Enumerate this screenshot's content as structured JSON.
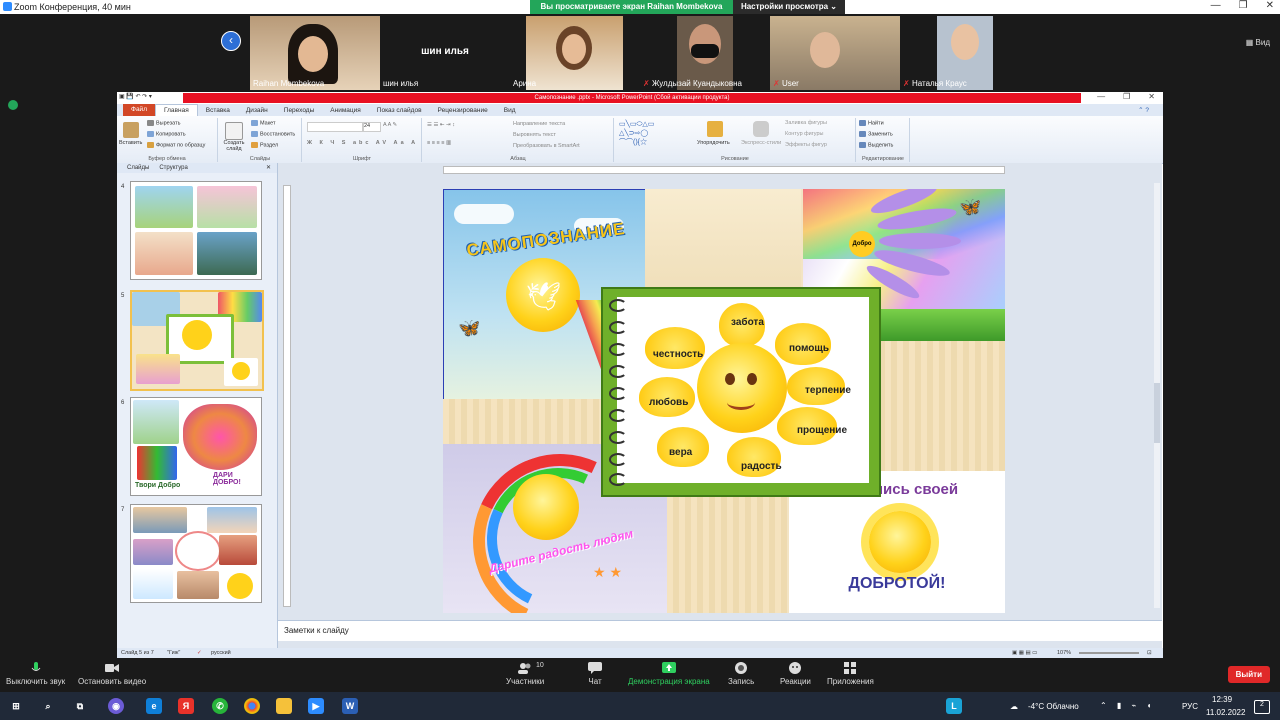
{
  "zoom": {
    "title": "Zoom Конференция, 40 мин",
    "share_banner": "Вы просматриваете экран Raihan Mombekova",
    "view_settings": "Настройки просмотра ⌄",
    "view_button": "Вид",
    "participants": [
      {
        "name": "Raihan Mombekova",
        "muted": false
      },
      {
        "name": "шин илья",
        "muted": false,
        "big_label": "шин илья"
      },
      {
        "name": "Арина",
        "muted": false
      },
      {
        "name": "Жулдызай Куандыковна",
        "muted": true
      },
      {
        "name": "User",
        "muted": true
      },
      {
        "name": "Наталья Краус",
        "muted": true
      }
    ],
    "toolbar": {
      "mute": "Выключить звук",
      "video": "Остановить видео",
      "participants": "Участники",
      "participants_count": "10",
      "chat": "Чат",
      "share": "Демонстрация экрана",
      "record": "Запись",
      "reactions": "Реакции",
      "apps": "Приложения",
      "exit": "Выйти"
    }
  },
  "ppt": {
    "window_title": "Самопознание .pptx - Microsoft PowerPoint (Сбой активации продукта)",
    "tabs": [
      "Файл",
      "Главная",
      "Вставка",
      "Дизайн",
      "Переходы",
      "Анимация",
      "Показ слайдов",
      "Рецензирование",
      "Вид"
    ],
    "ribbon": {
      "clipboard": {
        "label": "Буфер обмена",
        "paste": "Вставить",
        "cut": "Вырезать",
        "copy": "Копировать",
        "format": "Формат по образцу"
      },
      "slides": {
        "label": "Слайды",
        "create": "Создать слайд",
        "layout": "Макет",
        "reset": "Восстановить",
        "section": "Раздел"
      },
      "font": {
        "label": "Шрифт",
        "size": "24"
      },
      "paragraph": {
        "label": "Абзац",
        "direction": "Направление текста",
        "align": "Выровнять текст",
        "smartart": "Преобразовать в SmartArt"
      },
      "drawing": {
        "label": "Рисование",
        "arrange": "Упорядочить",
        "styles": "Экспресс-стили",
        "fill": "Заливка фигуры",
        "outline": "Контур фигуры",
        "effects": "Эффекты фигур"
      },
      "editing": {
        "label": "Редактирование",
        "find": "Найти",
        "replace": "Заменить",
        "select": "Выделить"
      }
    },
    "panel_tabs": [
      "Слайды",
      "Структура"
    ],
    "slide_numbers": [
      "4",
      "5",
      "6",
      "7"
    ],
    "thumb_texts": {
      "t6a": "Твори Добро",
      "t6b": "ДАРИ ДОБРО!"
    },
    "notes_placeholder": "Заметки к слайду",
    "status": {
      "slide": "Слайд 5 из 7",
      "theme": "\"Гиж\"",
      "lang": "русский",
      "zoom": "107%"
    },
    "slide": {
      "title_arc": "САМОПОЗНАНИЕ",
      "sun_words": [
        "забота",
        "помощь",
        "терпение",
        "прощение",
        "радость",
        "вера",
        "любовь",
        "честность"
      ],
      "rainbow_text": "Дарите радость людям",
      "share_kindness_1": "Поделись своей",
      "share_kindness_2": "ДОБРОТОЙ!",
      "flower_center": "Добро"
    }
  },
  "taskbar": {
    "weather": "-4°C Облачно",
    "lang": "РУС",
    "time": "12:39",
    "date": "11.02.2022",
    "notif": "2"
  }
}
